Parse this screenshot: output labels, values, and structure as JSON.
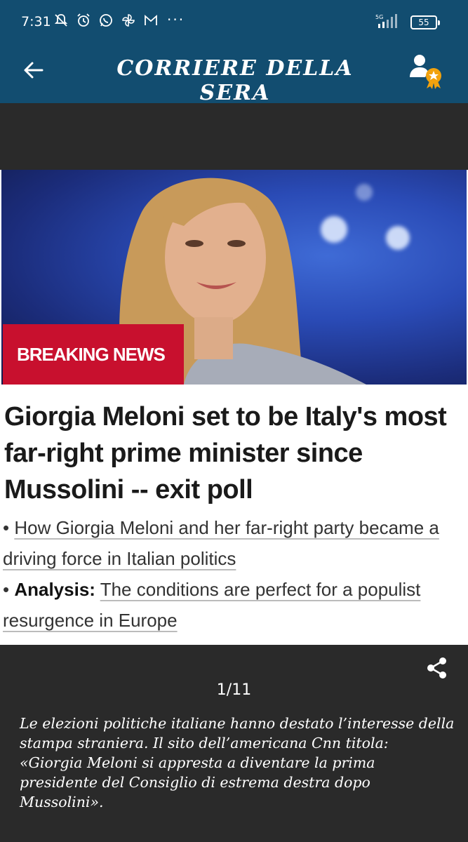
{
  "status_bar": {
    "time": "7:31",
    "more": "···",
    "network": "5G",
    "battery": "55"
  },
  "header": {
    "title": "CORRIERE DELLA SERA",
    "back_icon": "back-arrow-icon",
    "profile_icon": "profile-badge-icon"
  },
  "article": {
    "badge": "BREAKING NEWS",
    "headline": "Giorgia Meloni set to be Italy's most far-right prime minister since Mussolini -- exit poll",
    "bullet1": "How Giorgia Meloni and her far-right party became a driving force in Italian politics",
    "bullet2_bold": "Analysis:",
    "bullet2_text": "The conditions are perfect for a populist resurgence in Europe"
  },
  "gallery": {
    "counter": "1/11",
    "caption": "Le elezioni politiche italiane hanno destato l’interesse della stampa straniera. Il sito dell’americana Cnn titola: «Giorgia Meloni si appresta a diventare la prima presidente del Consiglio di estrema destra dopo Mussolini».",
    "share_icon": "share-icon"
  },
  "colors": {
    "header_bg": "#124d70",
    "badge_red": "#c8102e",
    "page_bg": "#2a2a2a"
  }
}
